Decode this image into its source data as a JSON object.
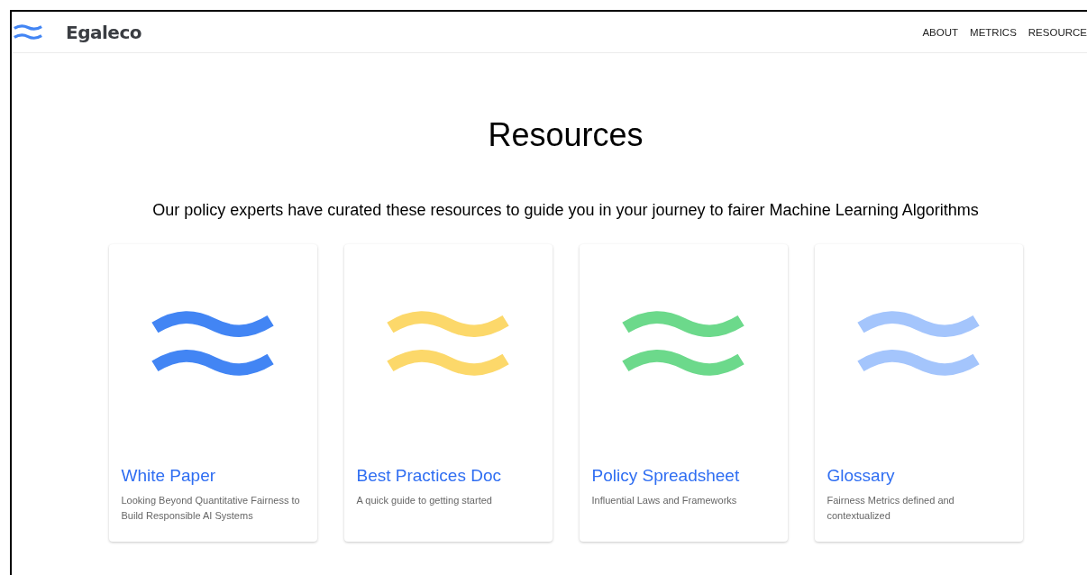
{
  "header": {
    "brand": "Egaleco",
    "nav": [
      "ABOUT",
      "METRICS",
      "RESOURCE"
    ]
  },
  "title": "Resources",
  "subtitle": "Our policy experts have curated these resources to guide you in your journey to fairer Machine Learning Algorithms",
  "cards": [
    {
      "title": "White Paper",
      "description": "Looking Beyond Quantitative Fairness to Build Responsible AI Systems",
      "color": "#4285f4"
    },
    {
      "title": "Best Practices Doc",
      "description": "A quick guide to getting started",
      "color": "#fcd86a"
    },
    {
      "title": "Policy Spreadsheet",
      "description": "Influential Laws and Frameworks",
      "color": "#6cd98b"
    },
    {
      "title": "Glossary",
      "description": "Fairness Metrics defined and contextualized",
      "color": "#a4c5fc"
    }
  ]
}
